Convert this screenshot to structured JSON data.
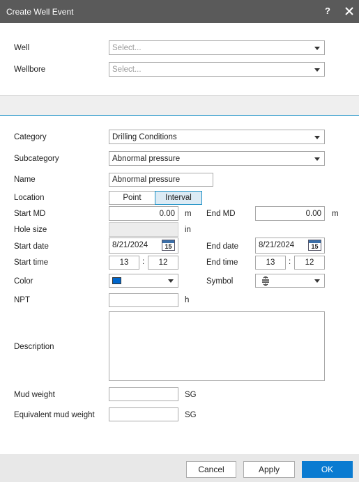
{
  "window": {
    "title": "Create Well Event",
    "help_glyph": "?"
  },
  "well": {
    "label": "Well",
    "placeholder": "Select..."
  },
  "wellbore": {
    "label": "Wellbore",
    "placeholder": "Select..."
  },
  "category": {
    "label": "Category",
    "value": "Drilling Conditions"
  },
  "subcategory": {
    "label": "Subcategory",
    "value": "Abnormal pressure"
  },
  "name": {
    "label": "Name",
    "value": "Abnormal pressure"
  },
  "location": {
    "label": "Location",
    "options": [
      "Point",
      "Interval"
    ],
    "selected": "Interval"
  },
  "start_md": {
    "label": "Start MD",
    "value": "0.00",
    "unit": "m"
  },
  "end_md": {
    "label": "End MD",
    "value": "0.00",
    "unit": "m"
  },
  "hole_size": {
    "label": "Hole size",
    "unit": "in"
  },
  "start_date": {
    "label": "Start date",
    "value": "8/21/2024"
  },
  "end_date": {
    "label": "End date",
    "value": "8/21/2024"
  },
  "calendar_day": "15",
  "start_time": {
    "label": "Start time",
    "hour": "13",
    "minute": "12"
  },
  "end_time": {
    "label": "End time",
    "hour": "13",
    "minute": "12"
  },
  "time_separator": ":",
  "color": {
    "label": "Color",
    "swatch": "#0066cc"
  },
  "symbol": {
    "label": "Symbol",
    "icon": "strikethrough-equals-icon"
  },
  "npt": {
    "label": "NPT",
    "unit": "h"
  },
  "description": {
    "label": "Description"
  },
  "mud_weight": {
    "label": "Mud weight",
    "unit": "SG"
  },
  "equivalent_mud_weight": {
    "label": "Equivalent mud weight",
    "unit": "SG"
  },
  "buttons": {
    "cancel": "Cancel",
    "apply": "Apply",
    "ok": "OK"
  },
  "colors": {
    "titlebar": "#5a5a5a",
    "accent": "#1a8fc4",
    "primary": "#0a7bd1"
  }
}
